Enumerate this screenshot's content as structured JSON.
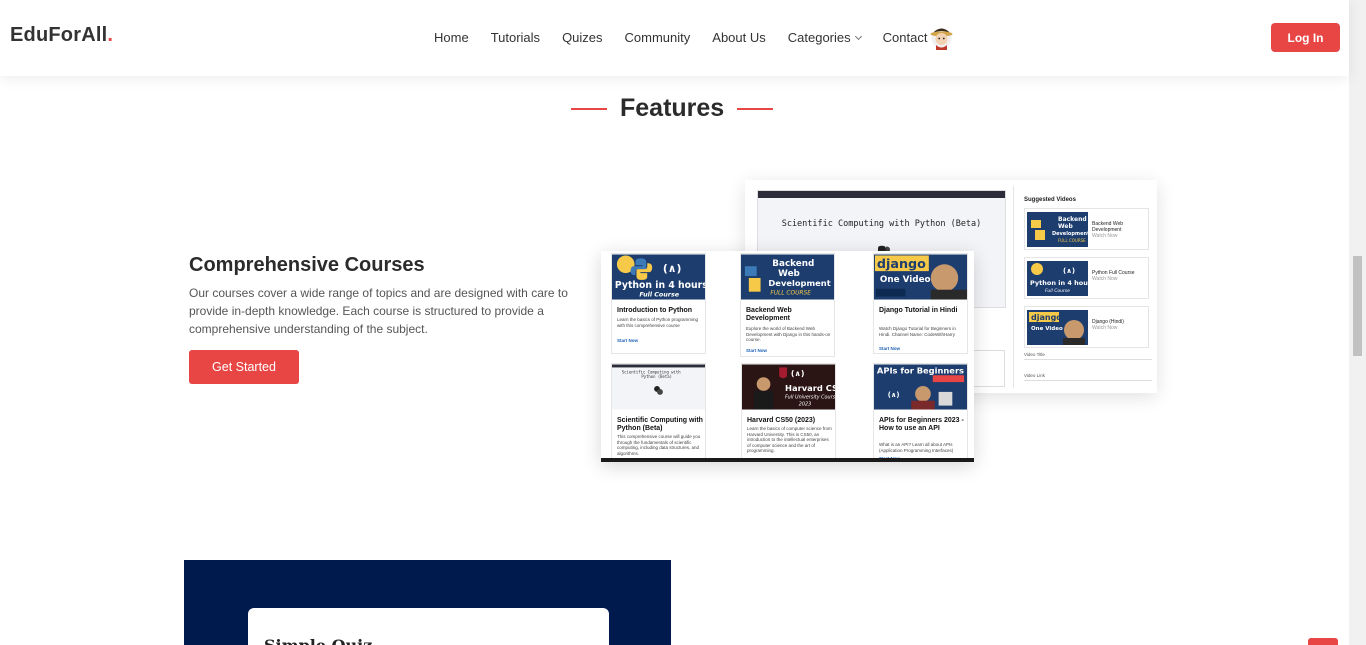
{
  "header": {
    "logo": "EduForAll",
    "logo_dot": ".",
    "nav": [
      "Home",
      "Tutorials",
      "Quizes",
      "Community",
      "About Us"
    ],
    "categories_label": "Categories",
    "contact_label": "Contact",
    "login_label": "Log In"
  },
  "section": {
    "title": "Features"
  },
  "feature": {
    "title": "Comprehensive Courses",
    "description": "Our courses cover a wide range of topics and are designed with care to provide in-depth knowledge. Each course is structured to provide a comprehensive understanding of the subject.",
    "button_label": "Get Started"
  },
  "screenshot_back": {
    "video_heading": "Scientific Computing with Python (Beta)",
    "suggested_title": "Suggested Videos",
    "suggested": [
      {
        "title": "Backend Web Development",
        "link": "Watch Now",
        "thumb": "backend"
      },
      {
        "title": "Python Full Course",
        "link": "Watch Now",
        "thumb": "python"
      },
      {
        "title": "Django (Hindi)",
        "link": "Watch Now",
        "thumb": "django"
      }
    ],
    "field_video_title": "Video Title",
    "field_video_link": "Video Link"
  },
  "screenshot_front": {
    "cards": [
      {
        "title": "Introduction to Python",
        "desc": "Learn the basics of Python programming with this comprehensive course",
        "link": "Start Now",
        "thumb_text": "Python in 4 hours",
        "thumb_sub": "Full Course"
      },
      {
        "title": "Backend Web Development",
        "desc": "Explore the world of Backend Web Development with Django in this hands-on course.",
        "link": "Start Now",
        "thumb_text": "Backend Web Development",
        "thumb_sub": "FULL COURSE"
      },
      {
        "title": "Django Tutorial in Hindi",
        "desc": "Watch Django Tutorial for Beginners in Hindi. Channel Name: CodeWithHarry",
        "link": "Start Now",
        "thumb_text": "django",
        "thumb_sub": "One Video"
      },
      {
        "title": "Scientific Computing with Python (Beta)",
        "desc": "This comprehensive course will guide you through the fundamentals of scientific computing, including data structures, and algorithms.",
        "link": "",
        "thumb_text": "Scientific Computing with Python (Beta)",
        "thumb_sub": ""
      },
      {
        "title": "Harvard CS50 (2023)",
        "desc": "Learn the basics of computer science from Harvard University. This is CS50, an introduction to the intellectual enterprises of computer science and the art of programming.",
        "link": "Start Now",
        "thumb_text": "Harvard CS50",
        "thumb_sub": "Full University Course 2023"
      },
      {
        "title": "APIs for Beginners 2023 - How to use an API",
        "desc": "What is an API? Learn all about APIs (Application Programming Interfaces)",
        "link": "Start Now",
        "thumb_text": "APIs for Beginners",
        "thumb_sub": ""
      }
    ]
  },
  "quiz": {
    "title": "Simple Quiz"
  },
  "colors": {
    "accent": "#e84545",
    "navy": "#001a4d",
    "python_blue": "#1c3d6e",
    "python_yellow": "#f7c948"
  },
  "icons": {
    "avatar": "user-avatar-icon",
    "chevron": "chevron-down-icon"
  }
}
